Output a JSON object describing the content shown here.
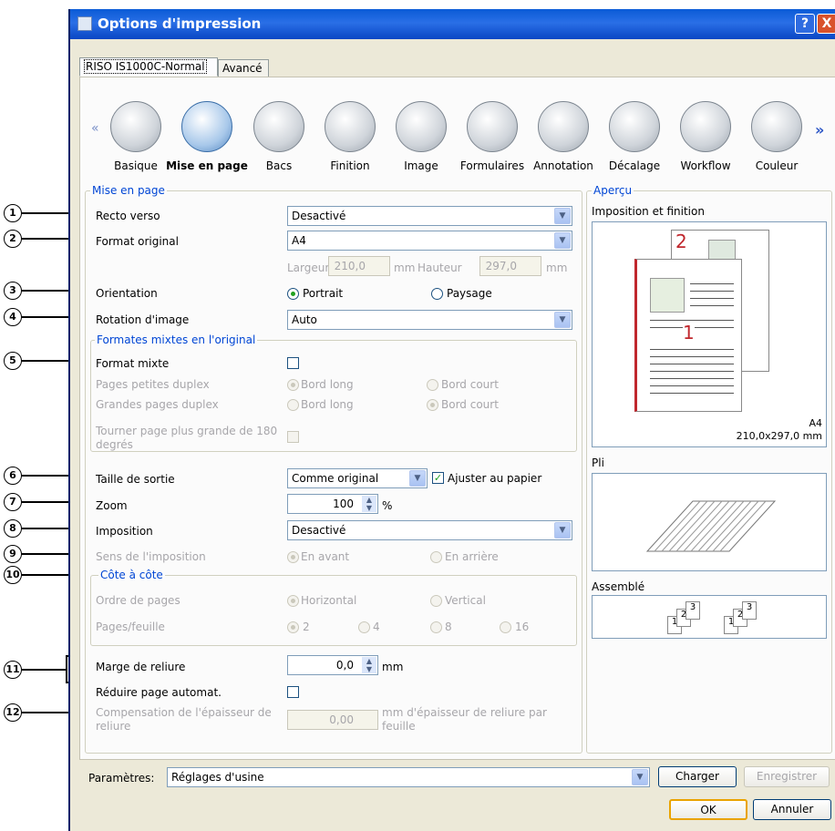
{
  "window": {
    "title": "Options d'impression",
    "help": "?",
    "close": "X"
  },
  "tabs": [
    "RISO IS1000C-Normal",
    "Avancé"
  ],
  "categories": {
    "prev": "«",
    "next": "»",
    "items": [
      "Basique",
      "Mise en page",
      "Bacs",
      "Finition",
      "Image",
      "Formulaires",
      "Annotation",
      "Décalage",
      "Workflow",
      "Couleur"
    ]
  },
  "layout": {
    "group_title": "Mise en page",
    "recto_verso": {
      "label": "Recto verso",
      "value": "Desactivé"
    },
    "format_original": {
      "label": "Format original",
      "value": "A4"
    },
    "dimensions": {
      "largeur_label": "Largeur",
      "largeur_value": "210,0",
      "unit1": "mm",
      "hauteur_label": "Hauteur",
      "hauteur_value": "297,0",
      "unit2": "mm"
    },
    "orientation": {
      "label": "Orientation",
      "opt1": "Portrait",
      "opt2": "Paysage"
    },
    "rotation": {
      "label": "Rotation d'image",
      "value": "Auto"
    },
    "mixed": {
      "title": "Formates mixtes en l'original",
      "format_mixte": "Format mixte",
      "petites": "Pages petites duplex",
      "grandes": "Grandes pages duplex",
      "bord_long": "Bord long",
      "bord_court": "Bord court",
      "tourner": "Tourner page plus grande de 180 degrés"
    },
    "taille": {
      "label": "Taille de sortie",
      "value": "Comme original",
      "ajuster": "Ajuster au papier"
    },
    "zoom": {
      "label": "Zoom",
      "value": "100",
      "unit": "%"
    },
    "imposition": {
      "label": "Imposition",
      "value": "Desactivé"
    },
    "sens": {
      "label": "Sens de l'imposition",
      "opt1": "En avant",
      "opt2": "En arrière"
    },
    "cote": {
      "title": "Côte à côte",
      "ordre": "Ordre de pages",
      "horizontal": "Horizontal",
      "vertical": "Vertical",
      "pages": "Pages/feuille",
      "p2": "2",
      "p4": "4",
      "p8": "8",
      "p16": "16"
    },
    "marge": {
      "label": "Marge de reliure",
      "value": "0,0",
      "unit": "mm"
    },
    "reduire": {
      "label": "Réduire page automat."
    },
    "compensation": {
      "label": "Compensation de l'épaisseur de reliure",
      "value": "0,00",
      "unit": "mm d'épaisseur de reliure par feuille"
    }
  },
  "apercu": {
    "title": "Aperçu",
    "imposition": "Imposition et finition",
    "page1": "1",
    "page2": "2",
    "format": "A4",
    "size": "210,0x297,0 mm",
    "pli": "Pli",
    "assemble": "Assemblé",
    "stack_nums": [
      "1",
      "2",
      "3"
    ]
  },
  "bottom": {
    "params_label": "Paramètres:",
    "params_value": "Réglages d'usine",
    "charger": "Charger",
    "enregistrer": "Enregistrer",
    "ok": "OK",
    "annuler": "Annuler"
  },
  "callouts": [
    "1",
    "2",
    "3",
    "4",
    "5",
    "6",
    "7",
    "8",
    "9",
    "10",
    "11",
    "12"
  ]
}
